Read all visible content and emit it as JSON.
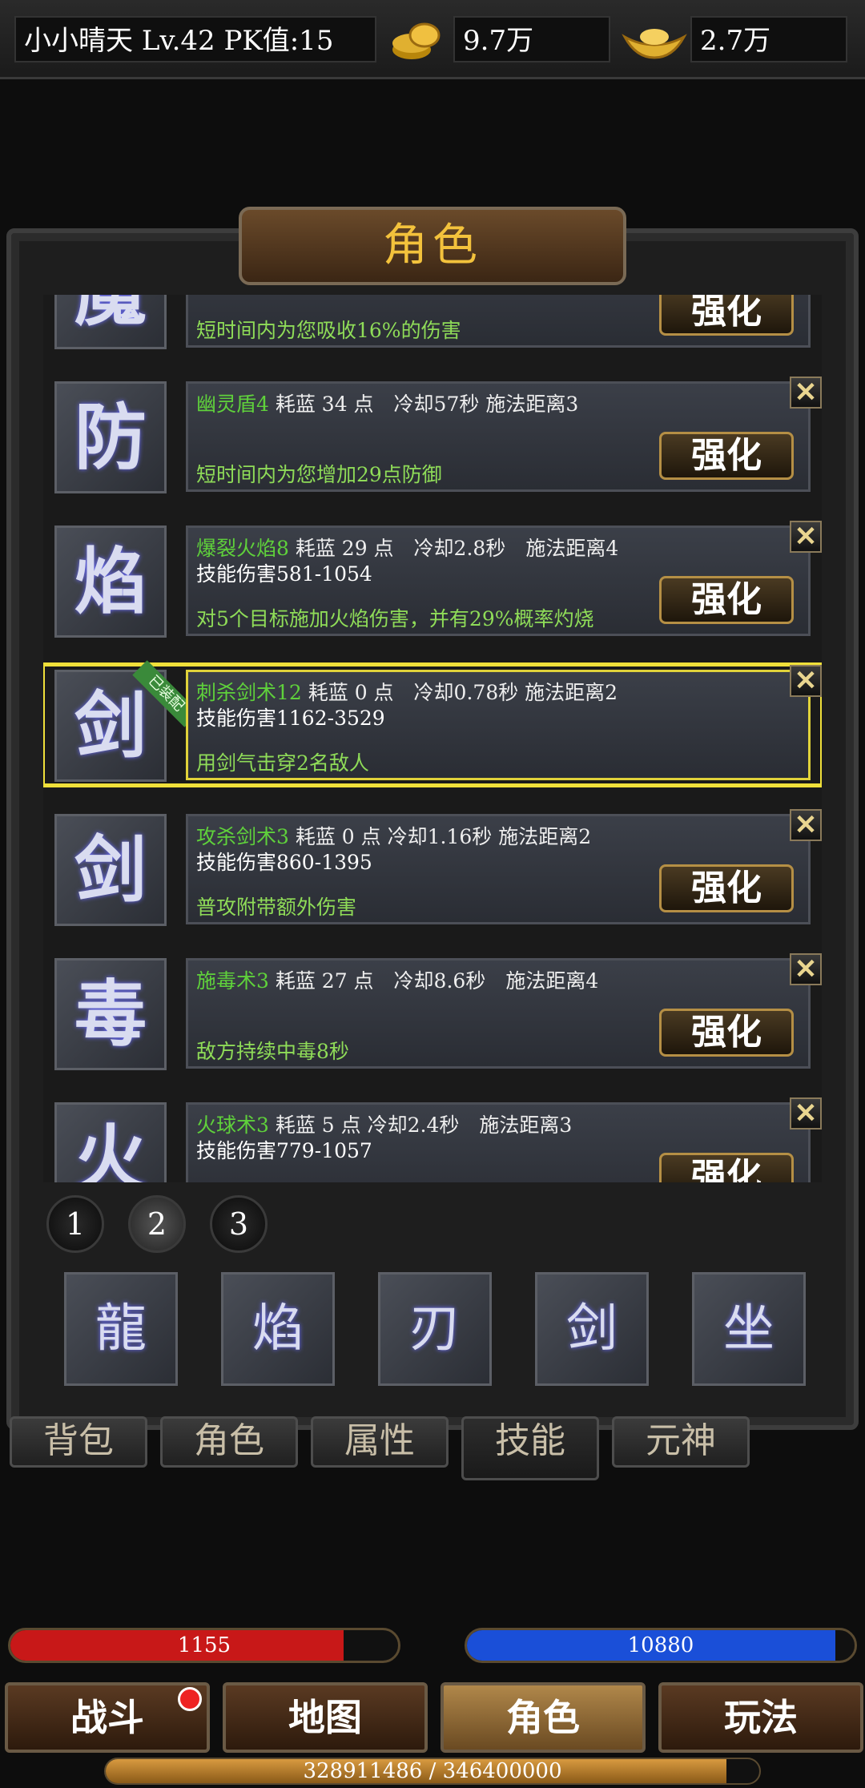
{
  "player": {
    "name": "小小晴天",
    "level": "Lv.42",
    "pk": "PK值:15"
  },
  "currency": {
    "coins": "9.7万",
    "ingots": "2.7万"
  },
  "panel": {
    "title": "角色"
  },
  "skills": [
    {
      "glyph": "魔",
      "name": "",
      "stats": "",
      "line2": "",
      "desc": "短时间内为您吸收16%的伤害",
      "action": "强化",
      "has_close": false
    },
    {
      "glyph": "防",
      "name": "幽灵盾4",
      "stats": " 耗蓝 34 点　冷却57秒 施法距离3",
      "line2": "",
      "desc": "短时间内为您增加29点防御",
      "action": "强化",
      "has_close": true
    },
    {
      "glyph": "焰",
      "name": "爆裂火焰8",
      "stats": " 耗蓝 29 点　冷却2.8秒　施法距离4",
      "line2": "技能伤害581-1054",
      "desc": "对5个目标施加火焰伤害，并有29%概率灼烧",
      "action": "强化",
      "has_close": true
    },
    {
      "glyph": "剑",
      "name": "刺杀剑术12",
      "stats": " 耗蓝 0 点　冷却0.78秒 施法距离2",
      "line2": "技能伤害1162-3529",
      "desc": "用剑气击穿2名敌人",
      "action": "",
      "has_close": true,
      "badge": "已装配",
      "selected": true
    },
    {
      "glyph": "剑",
      "name": "攻杀剑术3",
      "stats": " 耗蓝 0 点 冷却1.16秒 施法距离2",
      "line2": "技能伤害860-1395",
      "desc": "普攻附带额外伤害",
      "action": "强化",
      "has_close": true
    },
    {
      "glyph": "毒",
      "name": "施毒术3",
      "stats": " 耗蓝 27 点　冷却8.6秒　施法距离4",
      "line2": "",
      "desc": "敌方持续中毒8秒",
      "action": "强化",
      "has_close": true
    },
    {
      "glyph": "火",
      "name": "火球术3",
      "stats": " 耗蓝 5 点 冷却2.4秒　施法距离3",
      "line2": "技能伤害779-1057",
      "desc": "",
      "action": "强化",
      "has_close": true
    }
  ],
  "pages": [
    "1",
    "2",
    "3"
  ],
  "active_page": "2",
  "slots": [
    "龍",
    "焰",
    "刃",
    "剑",
    "坐"
  ],
  "subtabs": [
    "背包",
    "角色",
    "属性",
    "技能",
    "元神"
  ],
  "active_subtab": "技能",
  "hp": {
    "current": "1155",
    "fraction": 0.86
  },
  "mp": {
    "current": "10880",
    "fraction": 0.95
  },
  "nav": [
    "战斗",
    "地图",
    "角色",
    "玩法"
  ],
  "active_nav": "角色",
  "exp": {
    "text": "328911486 / 346400000",
    "fraction": 0.95
  },
  "colors": {
    "skill_name": "#5fd13b",
    "desc": "#8fdc58",
    "title": "#f3c23c",
    "hp": "#c81818",
    "mp": "#1a4fd8"
  }
}
